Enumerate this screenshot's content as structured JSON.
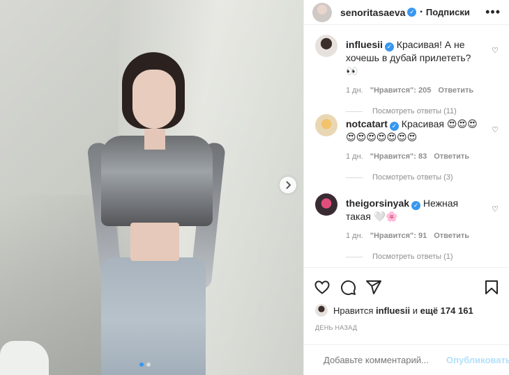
{
  "post_author": {
    "username": "senoritasaeva",
    "follow_label": "Подписки",
    "separator": "•"
  },
  "comments": [
    {
      "username": "influesii",
      "text": "Красивая! А не хочешь в дубай прилететь? 👀",
      "time": "1 дн.",
      "likes": "\"Нравится\": 205",
      "reply": "Ответить",
      "view_replies": "Посмотреть ответы (11)"
    },
    {
      "username": "notcatart",
      "text": "Красивая 😍😍😍😍😍😍😍😍😍😍",
      "time": "1 дн.",
      "likes": "\"Нравится\": 83",
      "reply": "Ответить",
      "view_replies": "Посмотреть ответы (3)"
    },
    {
      "username": "theigorsinyak",
      "text": "Нежная такая 🤍🌸",
      "time": "1 дн.",
      "likes": "\"Нравится\": 91",
      "reply": "Ответить",
      "view_replies": "Посмотреть ответы (1)"
    }
  ],
  "likes_summary": {
    "prefix": "Нравится",
    "user": "influesii",
    "connector": "и",
    "count": "ещё 174 161"
  },
  "date": "ДЕНЬ НАЗАД",
  "add_comment": {
    "placeholder": "Добавьте комментарий...",
    "post_label": "Опубликовать"
  },
  "icons": [
    "more-icon",
    "heart-icon",
    "comment-icon",
    "share-icon",
    "bookmark-icon",
    "emoji-icon",
    "chevron-right-icon",
    "verified-icon"
  ],
  "colors": {
    "verified": "#3897f0",
    "post_disabled": "#b2dffc",
    "muted": "#8e8e8e"
  },
  "carousel": {
    "current": 1,
    "total": 2
  }
}
